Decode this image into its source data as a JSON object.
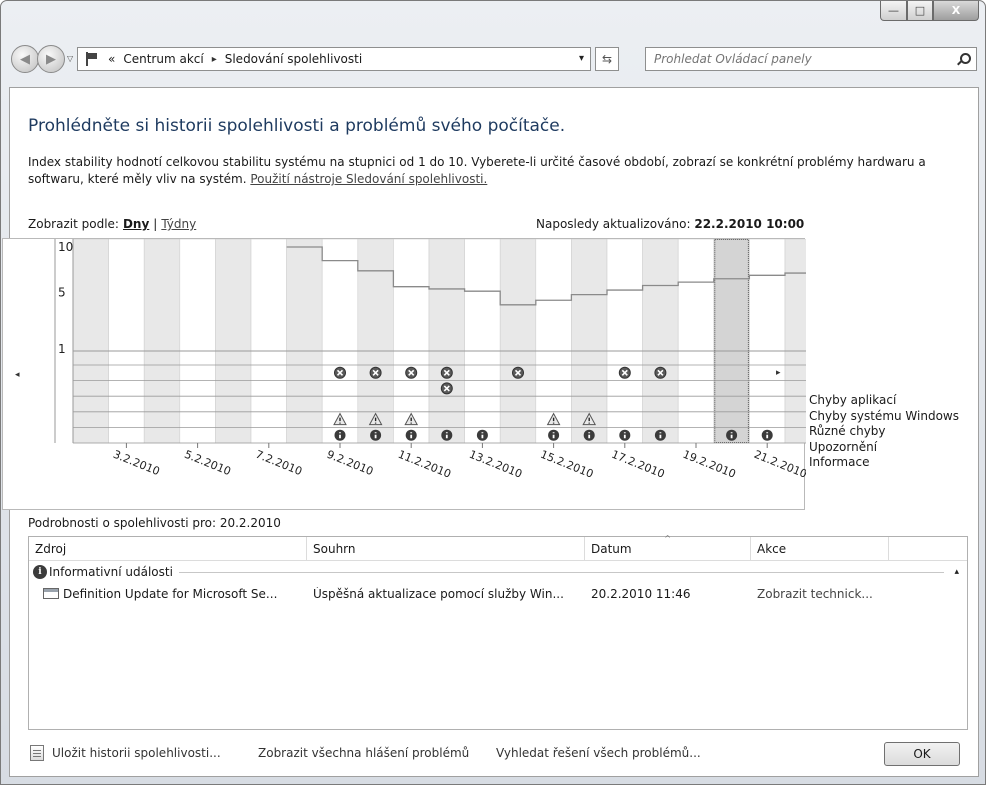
{
  "window": {
    "minimize": "—",
    "maximize": "□",
    "close": "X"
  },
  "address": {
    "overflow": "«",
    "crumbs": [
      "Centrum akcí",
      "Sledování spolehlivosti"
    ],
    "separator": "▸",
    "dropdown": "▾",
    "search_placeholder": "Prohledat Ovládací panely"
  },
  "page": {
    "title": "Prohlédněte si historii spolehlivosti a problémů svého počítače.",
    "description": "Index stability hodnotí celkovou stabilitu systému na stupnici od 1 do 10. Vyberete-li určité časové období, zobrazí se konkrétní problémy hardwaru a softwaru, které měly vliv na systém.",
    "help_link": "Použití nástroje Sledování spolehlivosti.",
    "view_by_label": "Zobrazit podle:",
    "view_days": "Dny",
    "view_sep": "|",
    "view_weeks": "Týdny",
    "last_updated_label": "Naposledy aktualizováno:",
    "last_updated_value": "22.2.2010 10:00"
  },
  "chart_data": {
    "type": "line",
    "y_ticks": [
      "10",
      "5",
      "1"
    ],
    "ylim": [
      1,
      10
    ],
    "dates": [
      "2.2.2010",
      "3.2.2010",
      "4.2.2010",
      "5.2.2010",
      "6.2.2010",
      "7.2.2010",
      "8.2.2010",
      "9.2.2010",
      "10.2.2010",
      "11.2.2010",
      "12.2.2010",
      "13.2.2010",
      "14.2.2010",
      "15.2.2010",
      "16.2.2010",
      "17.2.2010",
      "18.2.2010",
      "19.2.2010",
      "20.2.2010",
      "21.2.2010",
      "22.2.2010"
    ],
    "x_tick_labels": [
      "3.2.2010",
      "5.2.2010",
      "7.2.2010",
      "9.2.2010",
      "11.2.2010",
      "13.2.2010",
      "15.2.2010",
      "17.2.2010",
      "19.2.2010",
      "21.2.2010"
    ],
    "selected_date": "20.2.2010",
    "stability_index": [
      null,
      null,
      null,
      null,
      null,
      null,
      10.0,
      8.8,
      7.9,
      6.5,
      6.3,
      6.1,
      4.9,
      5.3,
      5.8,
      6.2,
      6.6,
      6.9,
      7.2,
      7.5,
      7.7
    ],
    "event_rows": [
      "Chyby aplikací",
      "Chyby systému Windows",
      "Různé chyby",
      "Upozornění",
      "Informace"
    ],
    "events": {
      "Chyby aplikací": [
        "9.2.2010",
        "10.2.2010",
        "11.2.2010",
        "12.2.2010",
        "14.2.2010",
        "17.2.2010",
        "18.2.2010"
      ],
      "Chyby systému Windows": [
        "12.2.2010"
      ],
      "Různé chyby": [],
      "Upozornění": [
        "9.2.2010",
        "10.2.2010",
        "11.2.2010",
        "15.2.2010",
        "16.2.2010"
      ],
      "Informace": [
        "9.2.2010",
        "10.2.2010",
        "11.2.2010",
        "12.2.2010",
        "13.2.2010",
        "15.2.2010",
        "16.2.2010",
        "17.2.2010",
        "18.2.2010",
        "20.2.2010",
        "21.2.2010"
      ]
    },
    "scroll_left": "◂",
    "scroll_right": "▸"
  },
  "details": {
    "label": "Podrobnosti o spolehlivosti pro: 20.2.2010",
    "columns": [
      "Zdroj",
      "Souhrn",
      "Datum",
      "Akce"
    ],
    "sort_indicator": "^",
    "group_label": "Informativní události",
    "group_toggle": "▴",
    "rows": [
      {
        "source": "Definition Update for Microsoft Se...",
        "summary": "Úspěšná aktualizace pomocí služby Win...",
        "date": "20.2.2010 11:46",
        "action": "Zobrazit technick..."
      }
    ]
  },
  "footer": {
    "save": "Uložit historii spolehlivosti...",
    "show_all": "Zobrazit všechna hlášení problémů",
    "check": "Vyhledat řešení všech problémů...",
    "ok": "OK"
  }
}
